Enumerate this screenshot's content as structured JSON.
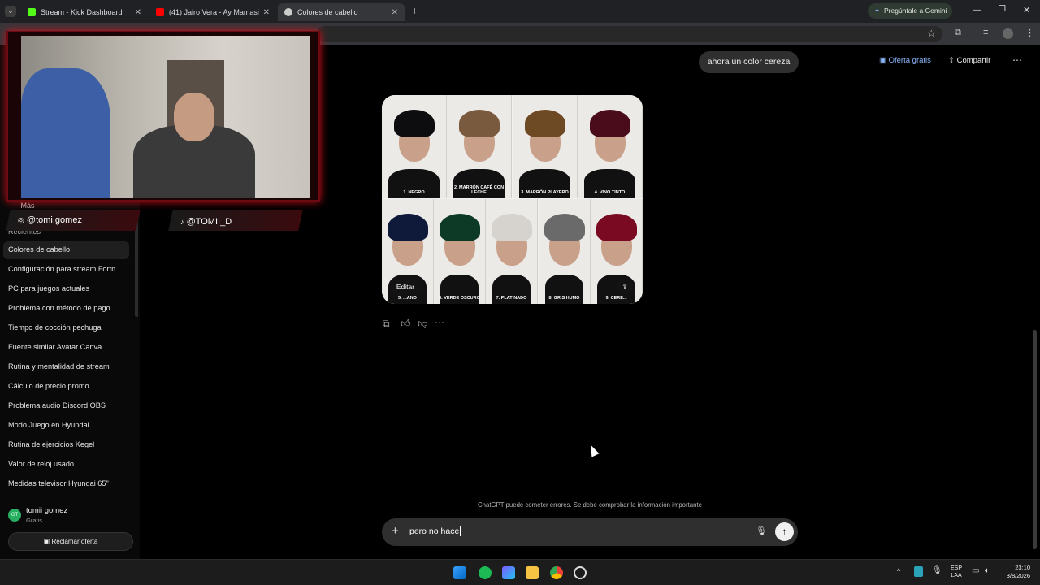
{
  "browser": {
    "tabs": [
      {
        "label": "Stream - Kick Dashboard",
        "color": "#53fc18"
      },
      {
        "label": "(41) Jairo Vera - Ay Mamasi",
        "color": "#ff0000"
      },
      {
        "label": "Colores de cabello",
        "color": "#cccccc"
      }
    ],
    "gemini_label": "Pregúntale a Gemini"
  },
  "header": {
    "user_message": "ahora un color cereza",
    "offer_label": "Oferta gratis",
    "share_label": "Compartir"
  },
  "stream_overlay": {
    "instagram": "@tomi.gomez",
    "tiktok": "@TOMII_D"
  },
  "sidebar": {
    "more_label": "Más",
    "section_label": "Recientes",
    "items": [
      "Colores de cabello",
      "Configuración para stream Fortn...",
      "PC para juegos actuales",
      "Problema con método de pago",
      "Tiempo de cocción pechuga",
      "Fuente similar Avatar Canva",
      "Rutina y mentalidad de stream",
      "Cálculo de precio promo",
      "Problema audio Discord OBS",
      "Modo Juego en Hyundai",
      "Rutina de ejercicios Kegel",
      "Valor de reloj usado",
      "Medidas televisor Hyundai 65\""
    ],
    "user_name": "tomii gomez",
    "user_plan": "Gratis",
    "avatar_initials": "GT",
    "claim_offer": "Reclamar oferta"
  },
  "image_grid": {
    "top_row": [
      {
        "caption": "1. NEGRO",
        "hair": "#0d0d0f"
      },
      {
        "caption": "2. MARRÓN CAFÉ CON LECHE",
        "hair": "#7a5a3e"
      },
      {
        "caption": "3. MARRÓN PLAYERO",
        "hair": "#6e4a24"
      },
      {
        "caption": "4. VINO TINTO",
        "hair": "#4a0c1a"
      }
    ],
    "bottom_row": [
      {
        "caption": "5. ...ANO",
        "hair": "#0f1a3a"
      },
      {
        "caption": "6. VERDE OSCURO",
        "hair": "#0c3a26"
      },
      {
        "caption": "7. PLATINADO",
        "hair": "#d6d3cf"
      },
      {
        "caption": "8. GRIS HUMO",
        "hair": "#6a6a6a"
      },
      {
        "caption": "9. CERE...",
        "hair": "#7a0a22"
      }
    ],
    "edit_label": "Editar"
  },
  "disclaimer": "ChatGPT puede cometer errores. Se debe comprobar la información importante",
  "composer": {
    "value": "pero no hace"
  },
  "system_tray": {
    "lang_top": "ESP",
    "lang_bottom": "LAA",
    "time": "23:10",
    "date": "3/8/2026"
  }
}
